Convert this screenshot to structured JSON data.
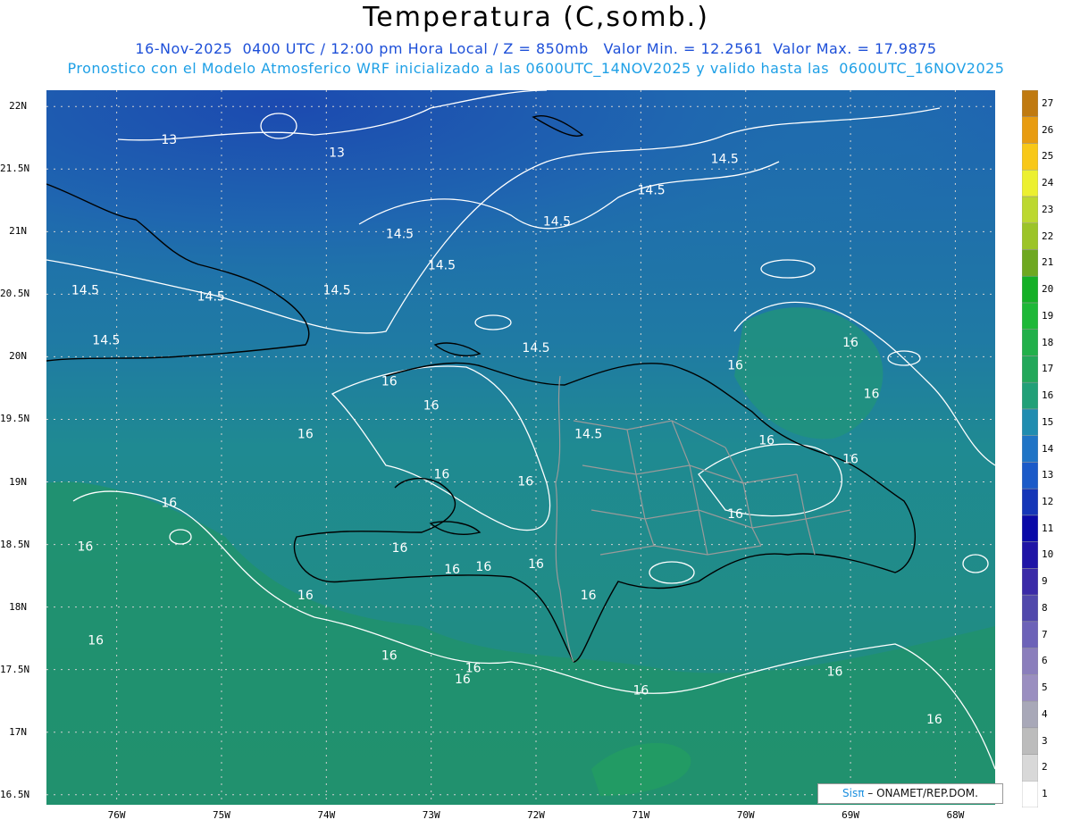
{
  "header": {
    "title": "Temperatura (C,somb.)",
    "line1": "16-Nov-2025  0400 UTC / 12:00 pm Hora Local / Z = 850mb   Valor Min. = 12.2561  Valor Max. = 17.9875",
    "line2": "Pronostico con el Modelo Atmosferico WRF inicializado a las 0600UTC_14NOV2025 y valido hasta las  0600UTC_16NOV2025"
  },
  "map": {
    "lat_labels": [
      "22N",
      "21.5N",
      "21N",
      "20.5N",
      "20N",
      "19.5N",
      "19N",
      "18.5N",
      "18N",
      "17.5N",
      "17N",
      "16.5N"
    ],
    "lon_labels": [
      "76W",
      "75W",
      "74W",
      "73W",
      "72W",
      "71W",
      "70W",
      "69W",
      "68W"
    ],
    "contour_labels": [
      {
        "text": "13",
        "lon": -75.5,
        "lat": 21.7
      },
      {
        "text": "13",
        "lon": -73.9,
        "lat": 21.6
      },
      {
        "text": "14.5",
        "lon": -70.2,
        "lat": 21.55
      },
      {
        "text": "14.5",
        "lon": -70.9,
        "lat": 21.3
      },
      {
        "text": "14.5",
        "lon": -71.8,
        "lat": 21.05
      },
      {
        "text": "14.5",
        "lon": -73.3,
        "lat": 20.95
      },
      {
        "text": "14.5",
        "lon": -72.9,
        "lat": 20.7
      },
      {
        "text": "14.5",
        "lon": -76.3,
        "lat": 20.5
      },
      {
        "text": "14.5",
        "lon": -75.1,
        "lat": 20.45
      },
      {
        "text": "14.5",
        "lon": -73.9,
        "lat": 20.5
      },
      {
        "text": "14.5",
        "lon": -76.1,
        "lat": 20.1
      },
      {
        "text": "14.5",
        "lon": -72.0,
        "lat": 20.04
      },
      {
        "text": "14.5",
        "lon": -71.5,
        "lat": 19.35
      },
      {
        "text": "16",
        "lon": -73.4,
        "lat": 19.77
      },
      {
        "text": "16",
        "lon": -73.0,
        "lat": 19.58
      },
      {
        "text": "16",
        "lon": -74.2,
        "lat": 19.35
      },
      {
        "text": "16",
        "lon": -72.9,
        "lat": 19.03
      },
      {
        "text": "16",
        "lon": -72.1,
        "lat": 18.97
      },
      {
        "text": "16",
        "lon": -75.5,
        "lat": 18.8
      },
      {
        "text": "16",
        "lon": -76.3,
        "lat": 18.45
      },
      {
        "text": "16",
        "lon": -73.3,
        "lat": 18.44
      },
      {
        "text": "16",
        "lon": -72.8,
        "lat": 18.27
      },
      {
        "text": "16",
        "lon": -72.5,
        "lat": 18.29
      },
      {
        "text": "16",
        "lon": -72.0,
        "lat": 18.31
      },
      {
        "text": "16",
        "lon": -71.5,
        "lat": 18.06
      },
      {
        "text": "16",
        "lon": -74.2,
        "lat": 18.06
      },
      {
        "text": "16",
        "lon": -76.2,
        "lat": 17.7
      },
      {
        "text": "16",
        "lon": -73.4,
        "lat": 17.58
      },
      {
        "text": "16",
        "lon": -72.6,
        "lat": 17.48
      },
      {
        "text": "16",
        "lon": -72.7,
        "lat": 17.39
      },
      {
        "text": "16",
        "lon": -71.0,
        "lat": 17.3
      },
      {
        "text": "16",
        "lon": -69.15,
        "lat": 17.45
      },
      {
        "text": "16",
        "lon": -68.2,
        "lat": 17.07
      },
      {
        "text": "16",
        "lon": -69.0,
        "lat": 20.08
      },
      {
        "text": "16",
        "lon": -70.1,
        "lat": 19.9
      },
      {
        "text": "16",
        "lon": -68.8,
        "lat": 19.67
      },
      {
        "text": "16",
        "lon": -69.8,
        "lat": 19.3
      },
      {
        "text": "16",
        "lon": -69.0,
        "lat": 19.15
      },
      {
        "text": "16",
        "lon": -70.1,
        "lat": 18.71
      }
    ]
  },
  "colorbar": {
    "labels": [
      "1",
      "2",
      "3",
      "4",
      "5",
      "6",
      "7",
      "8",
      "9",
      "10",
      "11",
      "12",
      "13",
      "14",
      "15",
      "16",
      "17",
      "18",
      "19",
      "20",
      "21",
      "22",
      "23",
      "24",
      "25",
      "26",
      "27"
    ],
    "colors": [
      "#ffffff",
      "#d8d8d8",
      "#bcbcbc",
      "#a8a8b8",
      "#9a8ec0",
      "#8a7ebc",
      "#6c62b8",
      "#5048ac",
      "#3a2aa8",
      "#1f14a6",
      "#0a0aa8",
      "#1436b8",
      "#1b5ac8",
      "#1f74c6",
      "#1f8cb0",
      "#21a078",
      "#22a85a",
      "#21b04a",
      "#1eb838",
      "#14b026",
      "#6ea820",
      "#9cc428",
      "#bcd830",
      "#ecf030",
      "#f8c818",
      "#e89c10",
      "#c07a10"
    ]
  },
  "credit": {
    "sis": "Sisπ",
    "rest": " – ONAMET/REP.DOM."
  },
  "colors": {
    "sub1": "#1d4fd8",
    "sub2": "#1fa0e6",
    "deep_blue": "#1d4fb4",
    "mid_blue": "#1f6fb0",
    "teal": "#1f8a9a",
    "green": "#219072"
  }
}
